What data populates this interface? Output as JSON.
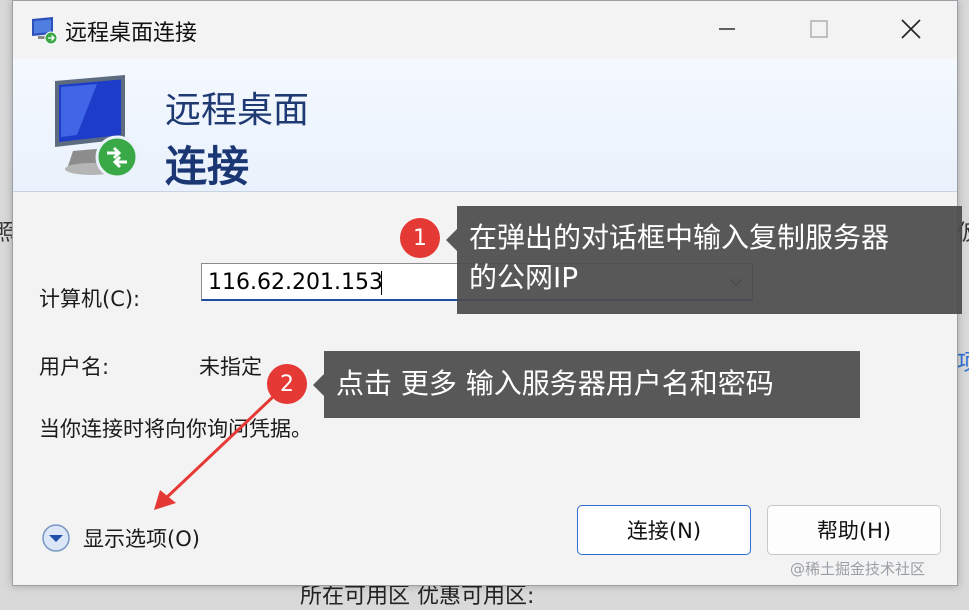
{
  "window": {
    "title": "远程桌面连接"
  },
  "banner": {
    "line1": "远程桌面",
    "line2": "连接"
  },
  "form": {
    "computer_label": "计算机(C):",
    "computer_value": "116.62.201.153",
    "username_label": "用户名:",
    "username_value": "未指定",
    "notice": "当你连接时将向你询问凭据。"
  },
  "buttons": {
    "show_options": "显示选项(O)",
    "connect": "连接(N)",
    "help": "帮助(H)"
  },
  "annotations": [
    {
      "number": "1",
      "text_line1": "在弹出的对话框中输入复制服务器",
      "text_line2": "的公网IP"
    },
    {
      "number": "2",
      "text": "点击 更多 输入服务器用户名和密码"
    }
  ],
  "background": {
    "left_fragment": "照",
    "right_fragment": "仮",
    "right_fragment2": "项",
    "bottom_fragment": "所在可用区        优惠可用区:"
  },
  "watermark": "@稀土掘金技术社区",
  "colors": {
    "accent": "#2f6fd4",
    "badge": "#e53935",
    "arrow": "#e53935",
    "tooltip": "#4b4b4b"
  }
}
